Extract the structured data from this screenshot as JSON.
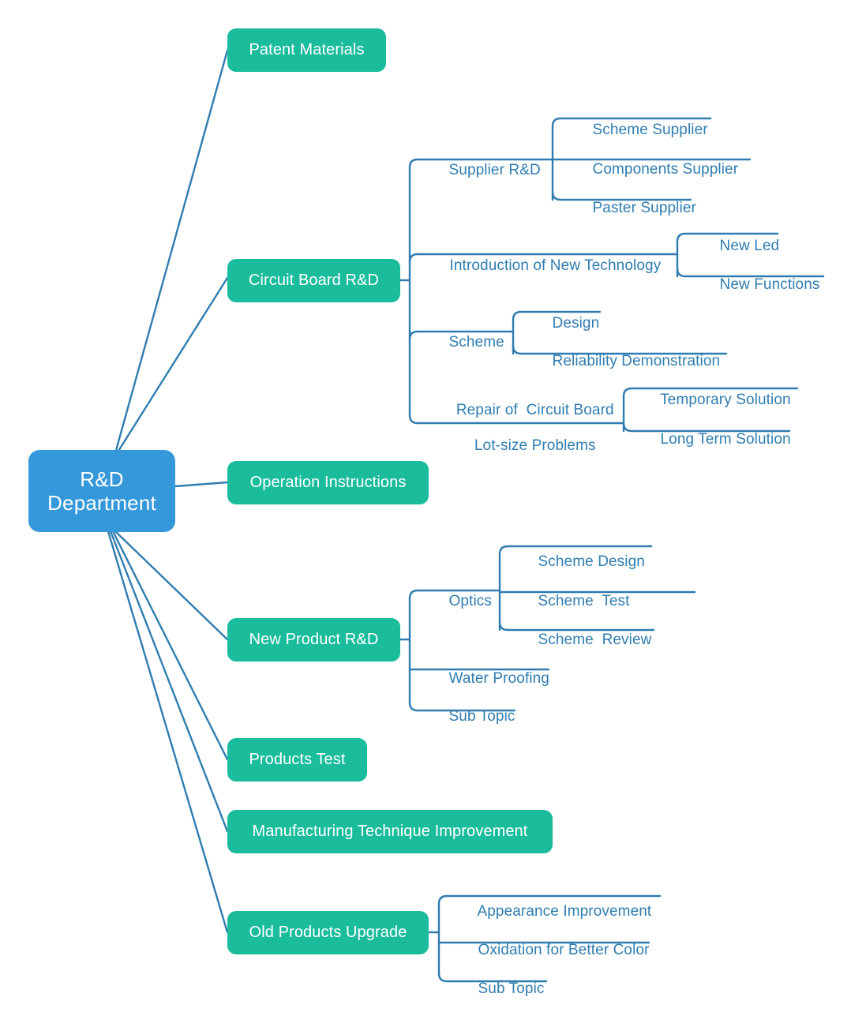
{
  "title": "R&D Department Mind Map",
  "colors": {
    "root_fill": "#3498db",
    "main_fill": "#1abc9c",
    "node_text": "#ffffff",
    "sub_text": "#2f7db0",
    "connector": "#2f7db0",
    "background": "#ffffff"
  },
  "root": {
    "label_line1": "R&D",
    "label_line2": "Department"
  },
  "branches": [
    {
      "id": "patent-materials",
      "label": "Patent Materials",
      "children": []
    },
    {
      "id": "circuit-board-rd",
      "label": "Circuit Board R&D",
      "children": [
        {
          "id": "supplier-rd",
          "label": "Supplier R&D",
          "children": [
            {
              "id": "scheme-supplier",
              "label": "Scheme Supplier"
            },
            {
              "id": "components-supplier",
              "label": "Components Supplier"
            },
            {
              "id": "paster-supplier",
              "label": "Paster Supplier"
            }
          ]
        },
        {
          "id": "introduction-of-new-technology",
          "label": "Introduction of New Technology",
          "children": [
            {
              "id": "new-led",
              "label": "New Led"
            },
            {
              "id": "new-functions",
              "label": "New Functions"
            }
          ]
        },
        {
          "id": "scheme",
          "label": "Scheme",
          "children": [
            {
              "id": "design",
              "label": "Design"
            },
            {
              "id": "reliability-demonstration",
              "label": "Reliability Demonstration"
            }
          ]
        },
        {
          "id": "repair-of-circuit-board-lot-size-problems",
          "label_line1": "Repair of  Circuit Board",
          "label_line2": "Lot-size Problems",
          "children": [
            {
              "id": "temporary-solution",
              "label": "Temporary Solution"
            },
            {
              "id": "long-term-solution",
              "label": "Long Term Solution"
            }
          ]
        }
      ]
    },
    {
      "id": "operation-instructions",
      "label": "Operation Instructions",
      "children": []
    },
    {
      "id": "new-product-rd",
      "label": "New Product R&D",
      "children": [
        {
          "id": "optics",
          "label": "Optics",
          "children": [
            {
              "id": "scheme-design",
              "label": "Scheme Design"
            },
            {
              "id": "scheme-test",
              "label": "Scheme  Test"
            },
            {
              "id": "scheme-review",
              "label": "Scheme  Review"
            }
          ]
        },
        {
          "id": "water-proofing",
          "label": "Water Proofing",
          "children": []
        },
        {
          "id": "sub-topic-npr",
          "label": "Sub Topic",
          "children": []
        }
      ]
    },
    {
      "id": "products-test",
      "label": "Products Test",
      "children": []
    },
    {
      "id": "manufacturing-technique-improvement",
      "label": "Manufacturing Technique Improvement",
      "children": []
    },
    {
      "id": "old-products-upgrade",
      "label": "Old Products Upgrade",
      "children": [
        {
          "id": "appearance-improvement",
          "label": "Appearance Improvement",
          "children": []
        },
        {
          "id": "oxidation-for-better-color",
          "label": "Oxidation for Better Color",
          "children": []
        },
        {
          "id": "sub-topic-opu",
          "label": "Sub Topic",
          "children": []
        }
      ]
    }
  ]
}
